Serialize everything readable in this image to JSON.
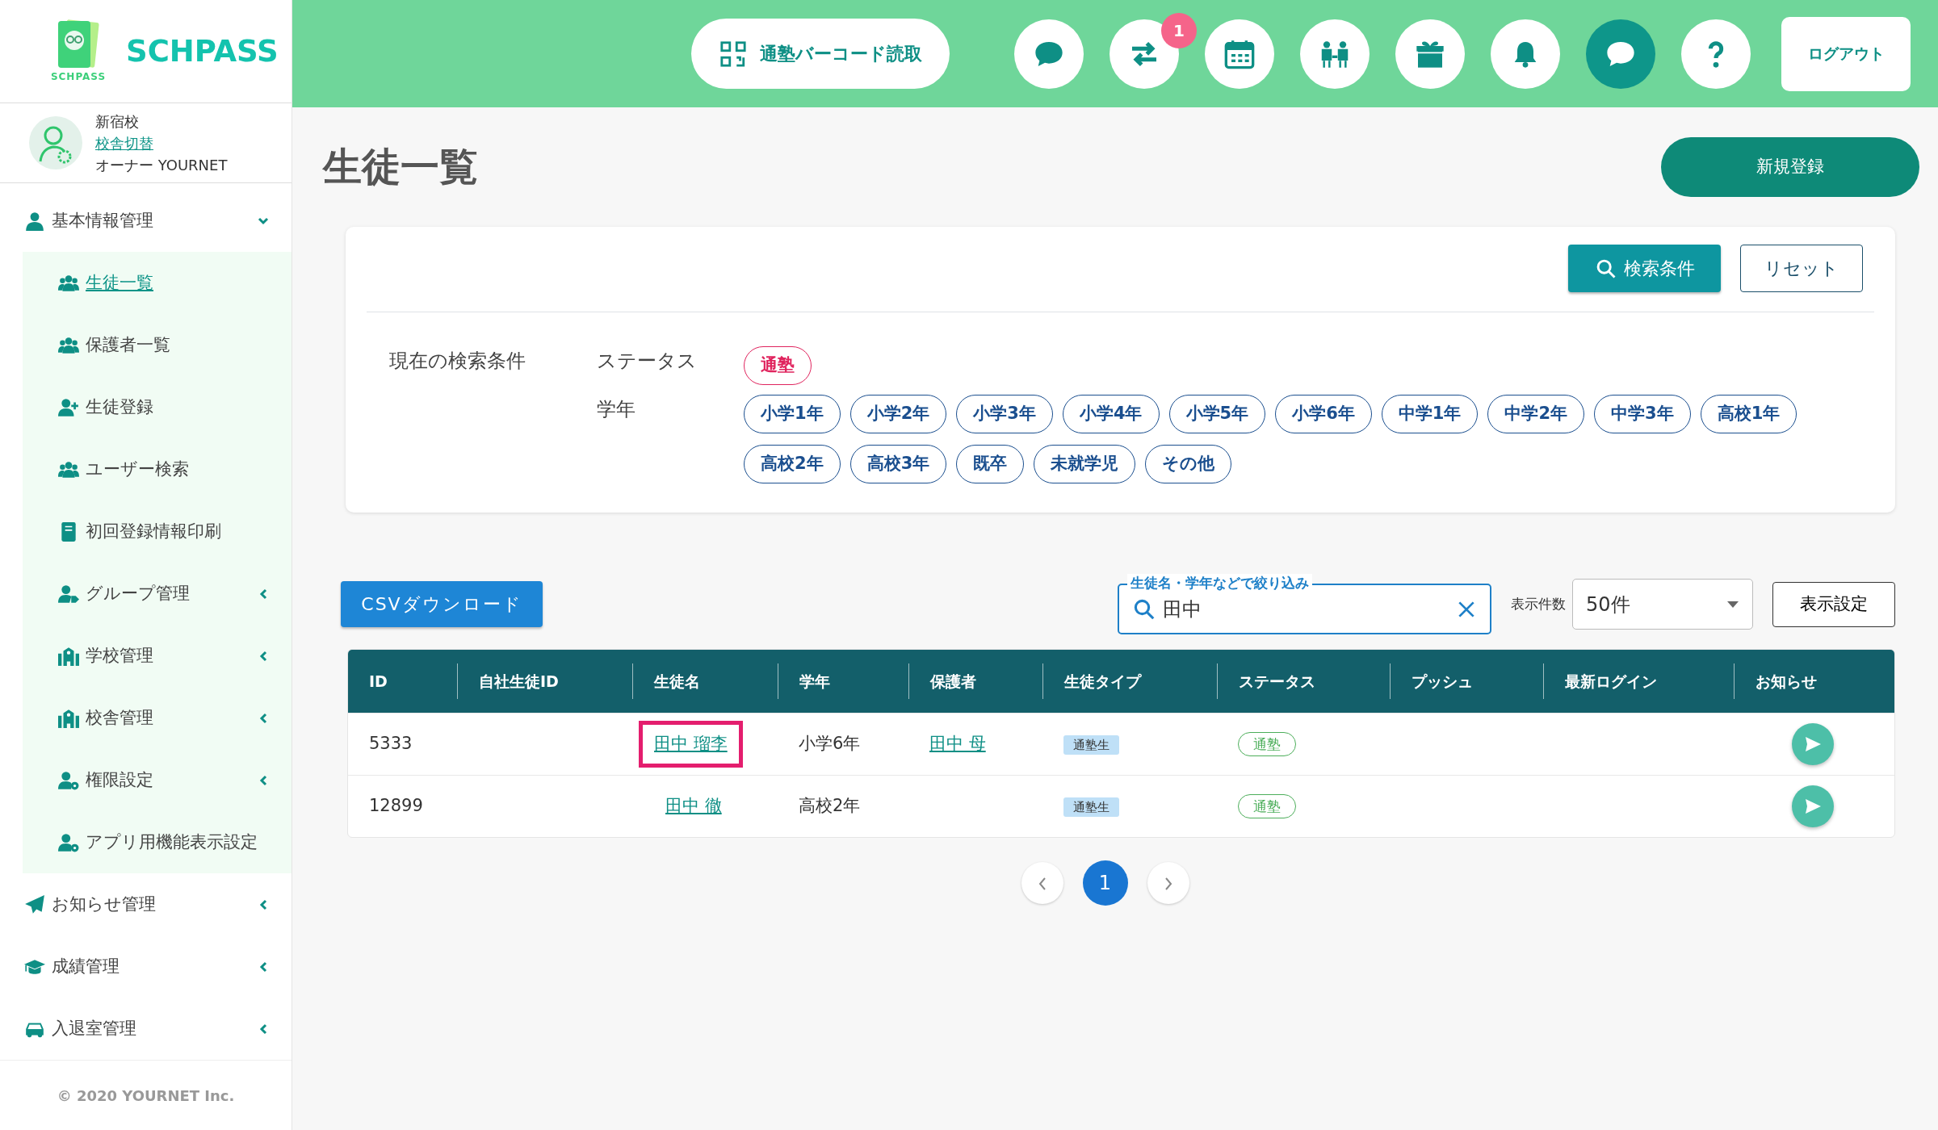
{
  "brand": {
    "logo_caption": "SCHPASS",
    "name": "SCHPASS"
  },
  "profile": {
    "school": "新宿校",
    "switch_link": "校舎切替",
    "owner": "オーナー YOURNET"
  },
  "sidebar": {
    "items": [
      {
        "label": "基本情報管理",
        "kind": "submenu",
        "expanded": true,
        "selected": false,
        "children": [
          {
            "label": "生徒一覧",
            "kind": "link",
            "selected": true
          },
          {
            "label": "保護者一覧",
            "kind": "link",
            "selected": false
          },
          {
            "label": "生徒登録",
            "kind": "link",
            "selected": false
          },
          {
            "label": "ユーザー検索",
            "kind": "link",
            "selected": false
          },
          {
            "label": "初回登録情報印刷",
            "kind": "link",
            "selected": false
          },
          {
            "label": "グループ管理",
            "kind": "submenu",
            "expanded": false,
            "selected": false
          },
          {
            "label": "学校管理",
            "kind": "submenu",
            "expanded": false,
            "selected": false
          },
          {
            "label": "校舎管理",
            "kind": "submenu",
            "expanded": false,
            "selected": false
          },
          {
            "label": "権限設定",
            "kind": "submenu",
            "expanded": false,
            "selected": false
          },
          {
            "label": "アプリ用機能表示設定",
            "kind": "link",
            "selected": false
          }
        ]
      },
      {
        "label": "お知らせ管理",
        "kind": "submenu",
        "expanded": false,
        "selected": false
      },
      {
        "label": "成績管理",
        "kind": "submenu",
        "expanded": false,
        "selected": false
      },
      {
        "label": "入退室管理",
        "kind": "submenu",
        "expanded": false,
        "selected": false
      }
    ]
  },
  "copyright": "© 2020 YOURNET Inc.",
  "header": {
    "barcode_button": "通塾バーコード読取",
    "icons": [
      {
        "selected": false
      },
      {
        "selected": false,
        "badge": "1"
      },
      {
        "selected": false
      },
      {
        "selected": false
      },
      {
        "selected": false
      },
      {
        "selected": false
      },
      {
        "selected": true
      },
      {
        "selected": false
      }
    ],
    "logout": "ログアウト"
  },
  "page": {
    "title": "生徒一覧",
    "new_button": "新規登録"
  },
  "search_panel": {
    "search_button": "検索条件",
    "reset_button": "リセット",
    "conditions_label": "現在の検索条件",
    "filters": [
      {
        "label": "ステータス",
        "chips": [
          {
            "text": "通塾",
            "kind": "status"
          }
        ]
      },
      {
        "label": "学年",
        "chips": [
          {
            "text": "小学1年",
            "kind": "grade"
          },
          {
            "text": "小学2年",
            "kind": "grade"
          },
          {
            "text": "小学3年",
            "kind": "grade"
          },
          {
            "text": "小学4年",
            "kind": "grade"
          },
          {
            "text": "小学5年",
            "kind": "grade"
          },
          {
            "text": "小学6年",
            "kind": "grade"
          },
          {
            "text": "中学1年",
            "kind": "grade"
          },
          {
            "text": "中学2年",
            "kind": "grade"
          },
          {
            "text": "中学3年",
            "kind": "grade"
          },
          {
            "text": "高校1年",
            "kind": "grade"
          },
          {
            "text": "高校2年",
            "kind": "grade"
          },
          {
            "text": "高校3年",
            "kind": "grade"
          },
          {
            "text": "既卒",
            "kind": "grade"
          },
          {
            "text": "未就学児",
            "kind": "grade"
          },
          {
            "text": "その他",
            "kind": "grade"
          }
        ]
      }
    ]
  },
  "toolbar": {
    "csv_button": "CSVダウンロード",
    "filter_field": {
      "label": "生徒名・学年などで絞り込み",
      "value": "田中"
    },
    "page_size_label": "表示件数",
    "page_size": "50件",
    "display_settings_button": "表示設定"
  },
  "table": {
    "columns": [
      "ID",
      "自社生徒ID",
      "生徒名",
      "学年",
      "保護者",
      "生徒タイプ",
      "ステータス",
      "プッシュ",
      "最新ログイン",
      "お知らせ"
    ],
    "rows": [
      {
        "id": "5333",
        "student_name": "田中 瑠李",
        "grade": "小学6年",
        "guardian": "田中 母",
        "student_type": "通塾生",
        "status": "通塾",
        "highlighted": true
      },
      {
        "id": "12899",
        "student_name": "田中 徹",
        "grade": "高校2年",
        "student_type": "通塾生",
        "status": "通塾",
        "highlighted": false
      }
    ]
  },
  "pagination": {
    "pages": [
      {
        "label": "1",
        "selected": true
      }
    ]
  }
}
